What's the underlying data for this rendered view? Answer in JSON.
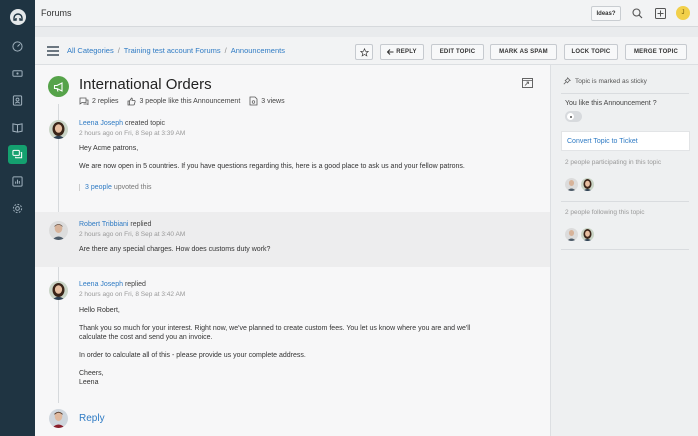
{
  "app": {
    "section_title": "Forums",
    "ideas_label": "Ideas?",
    "user_initial": "J"
  },
  "colors": {
    "sidebar_bg": "#1f3442",
    "accent_green": "#14a06f",
    "link_blue": "#2f7bc4",
    "topic_icon_green": "#56a34a"
  },
  "sidebar": {
    "items": [
      {
        "icon": "dashboard-icon"
      },
      {
        "icon": "tickets-icon"
      },
      {
        "icon": "contacts-icon"
      },
      {
        "icon": "knowledge-base-icon"
      },
      {
        "icon": "forums-icon",
        "active": true
      },
      {
        "icon": "reports-icon"
      },
      {
        "icon": "settings-icon"
      }
    ]
  },
  "breadcrumb": {
    "items": [
      "All Categories",
      "Training test account Forums",
      "Announcements"
    ]
  },
  "actions": {
    "reply": "REPLY",
    "edit": "EDIT TOPIC",
    "spam": "MARK AS SPAM",
    "lock": "LOCK TOPIC",
    "merge": "MERGE TOPIC"
  },
  "topic": {
    "title": "International Orders",
    "replies": "2 replies",
    "likes": "3 people like this Announcement",
    "views": "3 views"
  },
  "posts": [
    {
      "author": "Leena Joseph",
      "action": "created topic",
      "time": "2 hours ago on Fri, 8 Sep at 3:39 AM",
      "body": [
        "Hey Acme patrons,",
        "We are now open in 5 countries. If you have questions regarding this, here is a good place to ask us and your fellow patrons."
      ],
      "upvote_link": "3 people",
      "upvote_text": "upvoted this"
    },
    {
      "author": "Robert Tribbiani",
      "action": "replied",
      "time": "2 hours ago on Fri, 8 Sep at 3:40 AM",
      "body": [
        "Are there any special charges. How does customs duty work?"
      ]
    },
    {
      "author": "Leena Joseph",
      "action": "replied",
      "time": "2 hours ago on Fri, 8 Sep at 3:42 AM",
      "body": [
        "Hello Robert,",
        "Thank you so much for your interest. Right now, we've planned to create custom fees. You let us know where you are and we'll calculate the cost and send you an invoice.",
        "In order to calculate all of this - please provide us your complete address.",
        "Cheers,",
        "Leena"
      ]
    }
  ],
  "reply_link": "Reply",
  "right_panel": {
    "sticky": "Topic is marked as sticky",
    "like_question": "You like this Announcement ?",
    "convert": "Convert Topic to Ticket",
    "participating": "2 people participating in this topic",
    "following": "2 people following this topic"
  }
}
